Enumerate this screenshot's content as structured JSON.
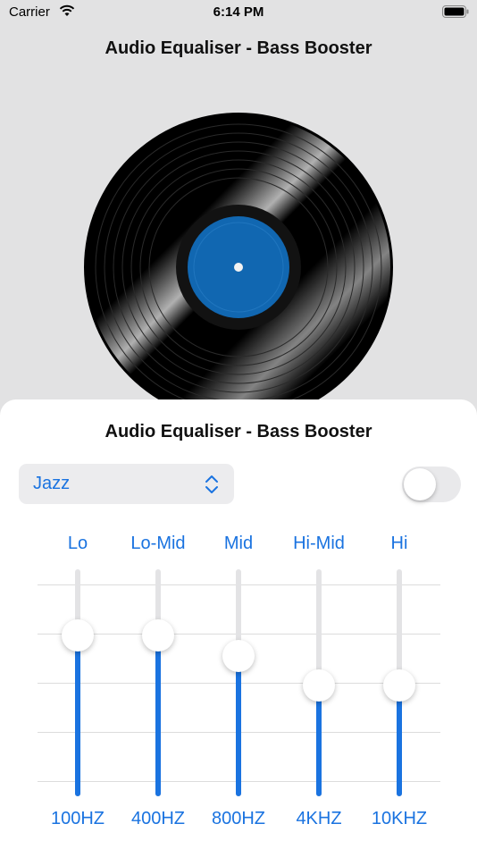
{
  "status_bar": {
    "carrier": "Carrier",
    "time": "6:14 PM"
  },
  "app_title": "Audio Equaliser - Bass Booster",
  "vinyl": {
    "label_color": "#1167b1",
    "icon": "vinyl-record"
  },
  "sheet": {
    "title": "Audio Equaliser - Bass Booster",
    "preset": {
      "value": "Jazz"
    },
    "toggle": {
      "on": false
    }
  },
  "bands": [
    {
      "name": "Lo",
      "freq": "100HZ",
      "level": 0.71
    },
    {
      "name": "Lo-Mid",
      "freq": "400HZ",
      "level": 0.71
    },
    {
      "name": "Mid",
      "freq": "800HZ",
      "level": 0.62
    },
    {
      "name": "Hi-Mid",
      "freq": "4KHZ",
      "level": 0.49
    },
    {
      "name": "Hi",
      "freq": "10KHZ",
      "level": 0.49
    }
  ],
  "colors": {
    "accent": "#1a73e0",
    "background": "#e2e2e3"
  }
}
